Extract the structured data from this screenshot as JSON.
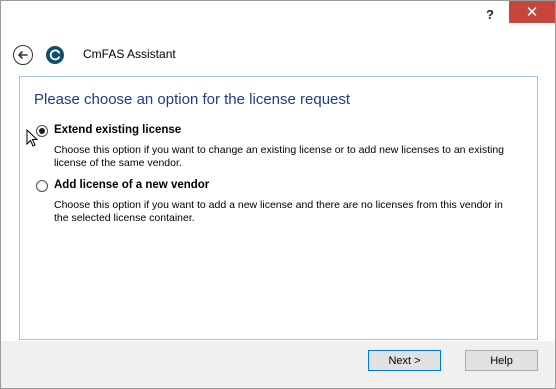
{
  "titlebar": {
    "help_label": "?",
    "close_label": "✕",
    "close_color": "#c7463b"
  },
  "navbar": {
    "back_icon": "back-arrow-icon",
    "app_icon": "cmfas-refresh-icon",
    "app_title": "CmFAS Assistant"
  },
  "main": {
    "heading": "Please choose an option for the license request",
    "options": [
      {
        "label": "Extend existing license",
        "description": "Choose this option if you want to change an existing license or to add new licenses to an existing license of the same vendor.",
        "checked": true
      },
      {
        "label": "Add license of a new vendor",
        "description": "Choose this option if you want to add a new license and there are no licenses from this vendor in the selected license container.",
        "checked": false
      }
    ]
  },
  "footer": {
    "next_label": "Next >",
    "help_label": "Help"
  },
  "colors": {
    "heading": "#1f3c88",
    "accent": "#0078d7"
  }
}
